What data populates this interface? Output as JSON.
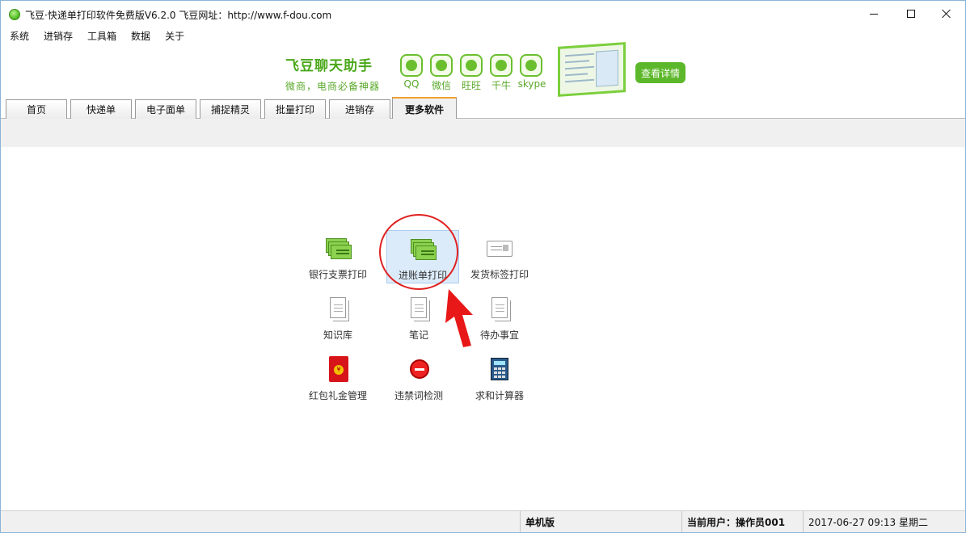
{
  "window": {
    "title": "飞豆·快递单打印软件免费版V6.2.0  飞豆网址：http://www.f-dou.com"
  },
  "menu": [
    "系统",
    "进销存",
    "工具箱",
    "数据",
    "关于"
  ],
  "banner": {
    "title": "飞豆聊天助手",
    "subtitle": "微商，电商必备神器",
    "apps": [
      "QQ",
      "微信",
      "旺旺",
      "千牛",
      "skype"
    ],
    "button": "查看详情"
  },
  "tabs": [
    {
      "label": "首页",
      "active": false
    },
    {
      "label": "快递单",
      "active": false
    },
    {
      "label": "电子面单",
      "active": false
    },
    {
      "label": "捕捉精灵",
      "active": false
    },
    {
      "label": "批量打印",
      "active": false
    },
    {
      "label": "进销存",
      "active": false
    },
    {
      "label": "更多软件",
      "active": true
    }
  ],
  "tools": [
    {
      "label": "银行支票打印",
      "icon": "bank-check-icon"
    },
    {
      "label": "进账单打印",
      "icon": "deposit-slip-icon",
      "selected": true
    },
    {
      "label": "发货标签打印",
      "icon": "shipping-label-icon"
    },
    {
      "label": "知识库",
      "icon": "knowledge-base-icon"
    },
    {
      "label": "笔记",
      "icon": "notes-icon"
    },
    {
      "label": "待办事宜",
      "icon": "todo-icon"
    },
    {
      "label": "红包礼金管理",
      "icon": "red-envelope-icon"
    },
    {
      "label": "违禁词检测",
      "icon": "forbidden-icon"
    },
    {
      "label": "求和计算器",
      "icon": "calculator-icon"
    }
  ],
  "status": {
    "edition": "单机版",
    "user": "当前用户：操作员001",
    "datetime": "2017-06-27 09:13 星期二"
  },
  "colors": {
    "accent_green": "#5cb82a",
    "annotation_red": "#e02020",
    "tab_active_top": "#f0a030"
  }
}
